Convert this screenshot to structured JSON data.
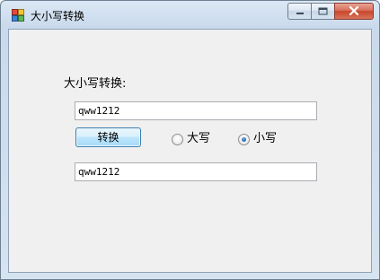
{
  "window": {
    "title": "大小写转换"
  },
  "form": {
    "heading": "大小写转换:",
    "input_value": "qww1212",
    "convert_button": "转换",
    "radio_upper_label": "大写",
    "radio_lower_label": "小写",
    "selected": "小写",
    "output_value": "qww1212"
  },
  "icons": {
    "app": "app-window-icon",
    "minimize": "minimize-icon",
    "maximize": "maximize-icon",
    "close": "close-icon"
  }
}
